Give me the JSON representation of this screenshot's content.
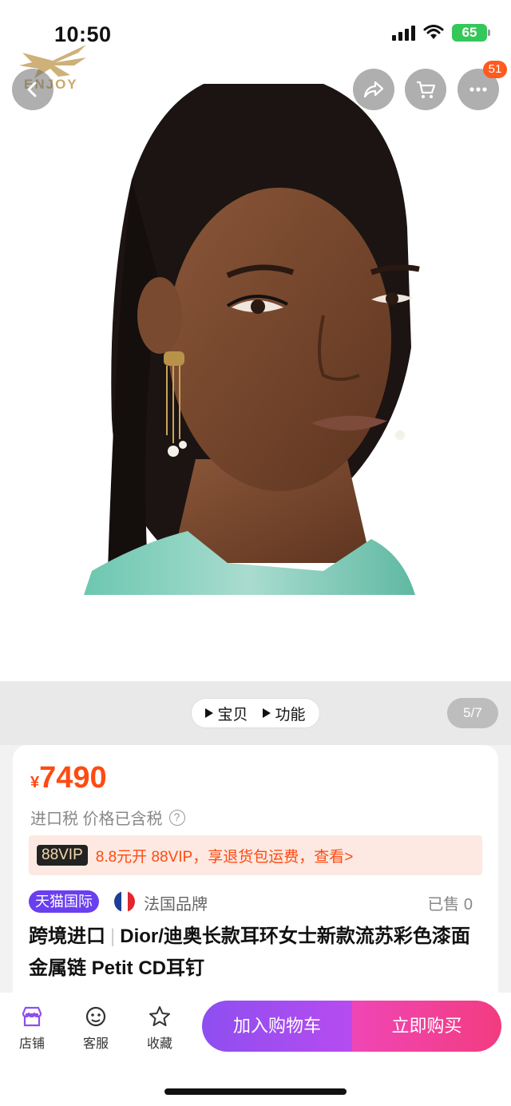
{
  "status": {
    "time": "10:50",
    "battery": "65"
  },
  "watermark": {
    "text": "ENJOY"
  },
  "nav": {
    "cart_badge": "51"
  },
  "media": {
    "tab_item": "宝贝",
    "tab_function": "功能",
    "counter": "5/7"
  },
  "product": {
    "currency": "¥",
    "price": "7490",
    "tax_note": "进口税 价格已含税",
    "vip_tag": "88VIP",
    "vip_text": "8.8元开 88VIP，享退货包运费，查看>",
    "store_tag": "天猫国际",
    "brand_origin": "法国品牌",
    "sold": "已售 0",
    "title_prefix": "跨境进口",
    "title": "Dior/迪奥长款耳环女士新款流苏彩色漆面金属链 Petit CD耳钉"
  },
  "bottom_bar": {
    "store_label": "店铺",
    "service_label": "客服",
    "favorite_label": "收藏",
    "add_to_cart": "加入购物车",
    "buy_now": "立即购买"
  },
  "colors": {
    "price": "#ff4a12",
    "tmall": "#6a3ff0",
    "cart_start": "#8e4ef0",
    "buy_end": "#f23c80"
  }
}
